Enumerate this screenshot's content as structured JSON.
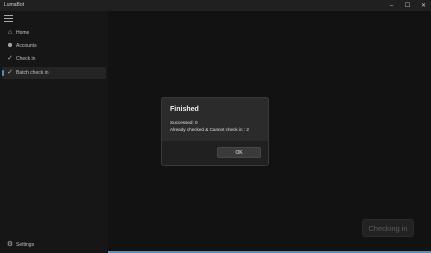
{
  "window": {
    "title": "LumaBot",
    "minimize_glyph": "–",
    "maximize_glyph": "☐",
    "close_glyph": "✕"
  },
  "sidebar": {
    "items": [
      {
        "label": "Home",
        "icon": "home-icon",
        "glyph": "⌂"
      },
      {
        "label": "Accounts",
        "icon": "accounts-icon",
        "glyph": "☻"
      },
      {
        "label": "Check in",
        "icon": "check-icon",
        "glyph": "✓"
      },
      {
        "label": "Batch check in",
        "icon": "check-icon",
        "glyph": "✓",
        "selected": true
      }
    ],
    "settings": {
      "label": "Settings",
      "icon": "gear-icon",
      "glyph": "⚙"
    }
  },
  "dialog": {
    "title": "Finished",
    "line1": "Successed: 0",
    "line2": "Already checked & Cannot check in : 2",
    "ok_label": "OK"
  },
  "main": {
    "checking_label": "Checking in",
    "progress": 1.0
  },
  "colors": {
    "accent": "#5fb2f2"
  }
}
